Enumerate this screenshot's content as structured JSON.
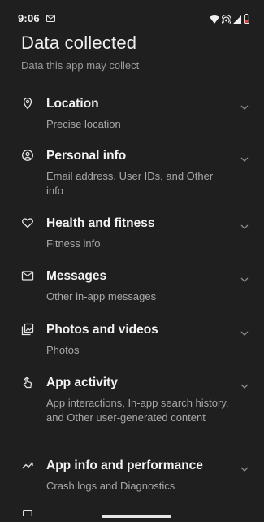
{
  "status_bar": {
    "time": "9:06",
    "left_icons": [
      "messages-icon"
    ],
    "right_icons": [
      "wifi-icon",
      "hotspot-icon",
      "signal-icon",
      "battery-low-icon"
    ],
    "battery_color": "#e0473e"
  },
  "header": {
    "title": "Data collected",
    "subtitle": "Data this app may collect"
  },
  "items": [
    {
      "icon": "location-pin-icon",
      "title": "Location",
      "description": "Precise location",
      "expanded": false
    },
    {
      "icon": "account-circle-icon",
      "title": "Personal info",
      "description": "Email address, User IDs, and Other info",
      "expanded": false
    },
    {
      "icon": "heart-icon",
      "title": "Health and fitness",
      "description": "Fitness info",
      "expanded": false
    },
    {
      "icon": "mail-icon",
      "title": "Messages",
      "description": "Other in-app messages",
      "expanded": false
    },
    {
      "icon": "photo-library-icon",
      "title": "Photos and videos",
      "description": "Photos",
      "expanded": false
    },
    {
      "icon": "touch-app-icon",
      "title": "App activity",
      "description": "App interactions, In-app search history, and Other user-generated content",
      "expanded": false
    },
    {
      "icon": "trending-up-icon",
      "title": "App info and performance",
      "description": "Crash logs and Diagnostics",
      "expanded": false
    }
  ],
  "colors": {
    "background": "#1f1f1f",
    "title_text": "#f2f2f2",
    "secondary_text": "#a8a8a8",
    "chevron": "#8d8d8d"
  }
}
